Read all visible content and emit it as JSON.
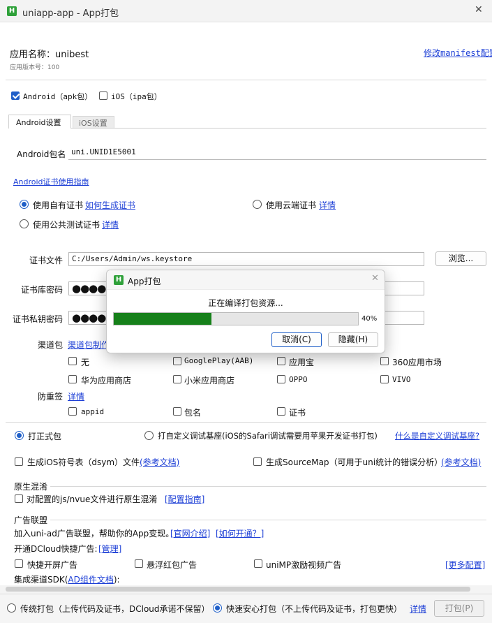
{
  "window": {
    "title": "uniapp-app - App打包",
    "close": "✕"
  },
  "app": {
    "name_label": "应用名称：unibest",
    "version_label": "应用版本号：100",
    "manifest_link": "修改manifest配置"
  },
  "platforms": {
    "android": {
      "label": "Android（apk包）",
      "checked": true
    },
    "ios": {
      "label": "iOS（ipa包）",
      "checked": false
    }
  },
  "tabs": {
    "android": "Android设置",
    "ios": "iOS设置"
  },
  "android": {
    "package_label": "Android包名",
    "package_value": "uni.UNID1E5001",
    "cert_guide": "Android证书使用指南",
    "cert_own": "使用自有证书",
    "cert_own_link": "如何生成证书",
    "cert_cloud": "使用云端证书",
    "cert_cloud_link": "详情",
    "cert_public": "使用公共测试证书",
    "cert_public_link": "详情",
    "cert_file_label": "证书文件",
    "cert_file_value": "C:/Users/Admin/ws.keystore",
    "browse": "浏览...",
    "store_pwd_label": "证书库密码",
    "key_pwd_label": "证书私钥密码",
    "password_mask": "●●●●",
    "channel_label": "渠道包",
    "channel_link": "渠道包制作",
    "channels": [
      "无",
      "GooglePlay(AAB)",
      "应用宝",
      "360应用市场",
      "华为应用商店",
      "小米应用商店",
      "OPPO",
      "VIVO"
    ],
    "tamper_label": "防重签",
    "tamper_link": "详情",
    "tamper_items": [
      "appid",
      "包名",
      "证书"
    ]
  },
  "build_type": {
    "formal": "打正式包",
    "custom": "打自定义调试基座(iOS的Safari调试需要用苹果开发证书打包)",
    "custom_link": "什么是自定义调试基座?"
  },
  "options": {
    "ios_symbols": "生成iOS符号表（dsym）文件",
    "ios_symbols_link": "(参考文档)",
    "sourcemap": "生成SourceMap（可用于uni统计的错误分析）",
    "sourcemap_link": "(参考文档)"
  },
  "obfuscation": {
    "title": "原生混淆",
    "item": "对配置的js/nvue文件进行原生混淆",
    "link": "[配置指南]"
  },
  "ads": {
    "title": "广告联盟",
    "intro": "加入uni-ad广告联盟，帮助你的App变现。",
    "intro_link1": "[官网介绍]",
    "intro_link2": "[如何开通？]",
    "dcloud_label": "开通DCloud快捷广告:",
    "dcloud_link": "[管理]",
    "splash": "快捷开屏广告",
    "float": "悬浮红包广告",
    "reward": "uniMP激励视频广告",
    "more": "[更多配置]",
    "sdk_prefix": "集成渠道SDK(",
    "sdk_link": "AD组件文档",
    "sdk_suffix": "):"
  },
  "footer": {
    "traditional": "传统打包（上传代码及证书，DCloud承诺不保留）",
    "safe": "快速安心打包（不上传代码及证书，打包更快）",
    "details": "详情",
    "build": "打包(P)"
  },
  "dialog": {
    "title": "App打包",
    "message": "正在编译打包资源...",
    "progress": 0.4,
    "progress_label": "40%",
    "cancel": "取消(C)",
    "hide": "隐藏(H)"
  },
  "colors": {
    "accent": "#1f5fc8",
    "link": "#1d3fd6",
    "progress": "#16801a",
    "logo": "#2fa13a"
  }
}
